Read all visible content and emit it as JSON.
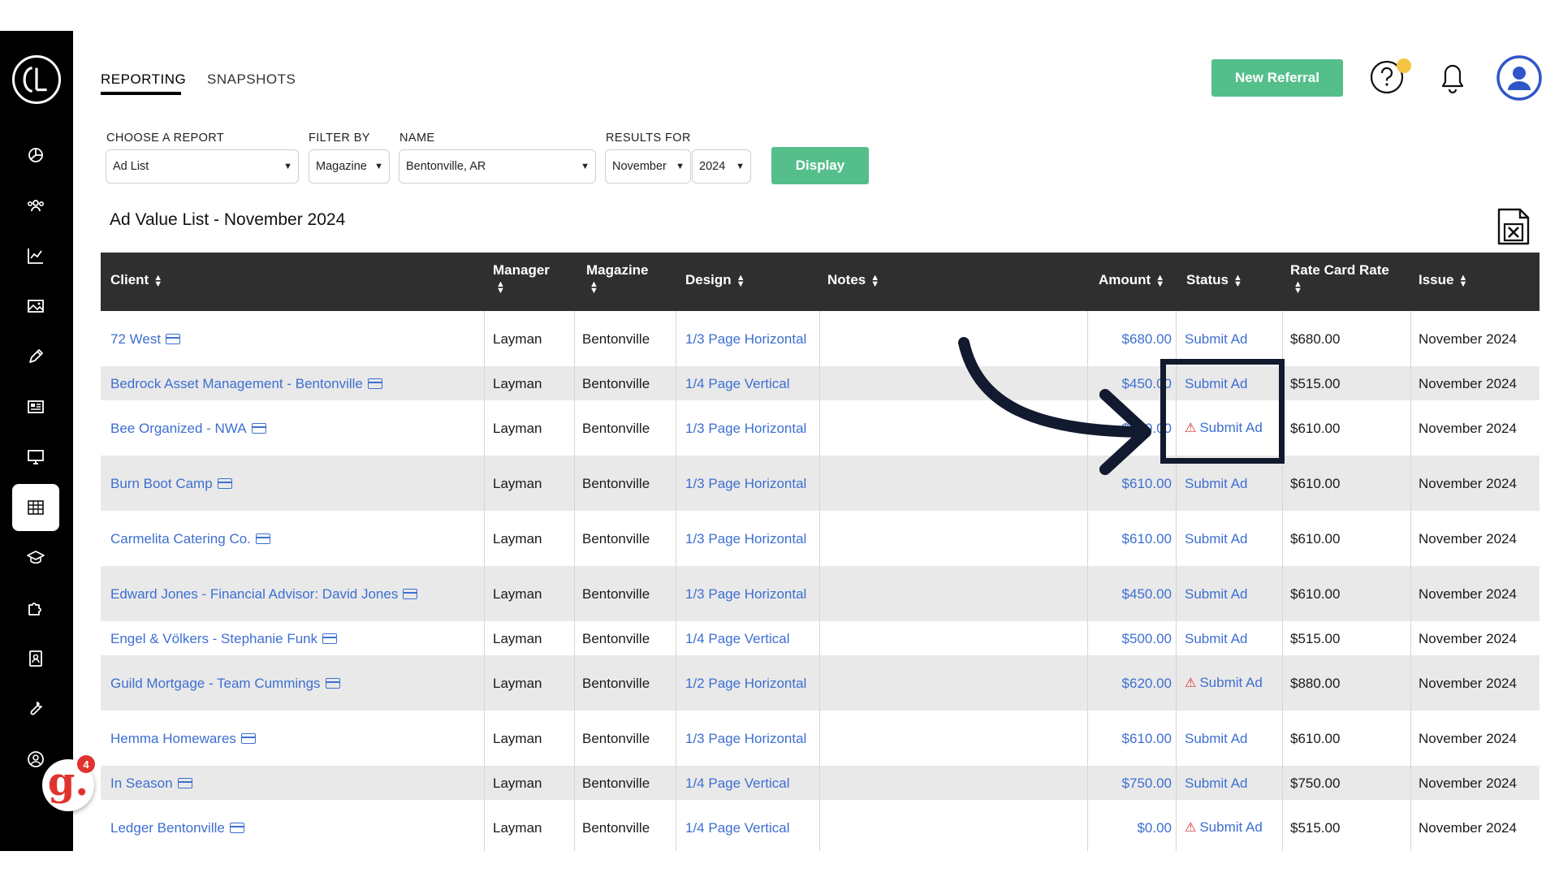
{
  "tabs": [
    {
      "label": "REPORTING",
      "active": true
    },
    {
      "label": "SNAPSHOTS",
      "active": false
    }
  ],
  "header": {
    "new_referral_label": "New Referral",
    "help_icon": "help-circle-icon",
    "bell_icon": "bell-icon",
    "avatar_icon": "user-avatar-icon"
  },
  "sidebar": {
    "logo": "CL",
    "items": [
      {
        "icon": "pie-chart-icon"
      },
      {
        "icon": "users-icon"
      },
      {
        "icon": "line-chart-icon"
      },
      {
        "icon": "image-icon"
      },
      {
        "icon": "pen-icon"
      },
      {
        "icon": "newspaper-icon"
      },
      {
        "icon": "monitor-icon"
      },
      {
        "icon": "table-grid-icon",
        "active": true
      },
      {
        "icon": "graduation-cap-icon"
      },
      {
        "icon": "puzzle-icon"
      },
      {
        "icon": "contact-book-icon"
      },
      {
        "icon": "wrench-icon"
      },
      {
        "icon": "user-circle-icon"
      }
    ]
  },
  "widget": {
    "letter": "g.",
    "count": "4"
  },
  "filters": {
    "report_label": "CHOOSE A REPORT",
    "report_value": "Ad List",
    "filter_label": "FILTER BY",
    "filter_value": "Magazine",
    "name_label": "NAME",
    "name_value": "Bentonville, AR",
    "results_label": "RESULTS FOR",
    "month_value": "November",
    "year_value": "2024",
    "display_label": "Display"
  },
  "page_title": "Ad Value List - November 2024",
  "colors": {
    "accent_green": "#55bf8b",
    "link_blue": "#3d6fd1",
    "header_dark": "#2f2f2f",
    "warning_red": "#d32f2f"
  },
  "table": {
    "headers": {
      "client": "Client",
      "manager": "Manager",
      "magazine": "Magazine",
      "design": "Design",
      "notes": "Notes",
      "amount": "Amount",
      "status": "Status",
      "rate": "Rate Card Rate",
      "issue": "Issue"
    },
    "rows": [
      {
        "client": "72 West",
        "manager": "Layman",
        "magazine": "Bentonville",
        "design": "1/3 Page Horizontal",
        "amount": "$680.00",
        "status": "Submit Ad",
        "warn": false,
        "rate": "$680.00",
        "issue": "November 2024"
      },
      {
        "client": "Bedrock Asset Management - Bentonville",
        "manager": "Layman",
        "magazine": "Bentonville",
        "design": "1/4 Page Vertical",
        "amount": "$450.00",
        "status": "Submit Ad",
        "warn": false,
        "rate": "$515.00",
        "issue": "November 2024"
      },
      {
        "client": "Bee Organized - NWA",
        "manager": "Layman",
        "magazine": "Bentonville",
        "design": "1/3 Page Horizontal",
        "amount": "$610.00",
        "status": "Submit Ad",
        "warn": true,
        "rate": "$610.00",
        "issue": "November 2024"
      },
      {
        "client": "Burn Boot Camp",
        "manager": "Layman",
        "magazine": "Bentonville",
        "design": "1/3 Page Horizontal",
        "amount": "$610.00",
        "status": "Submit Ad",
        "warn": false,
        "rate": "$610.00",
        "issue": "November 2024"
      },
      {
        "client": "Carmelita Catering Co.",
        "manager": "Layman",
        "magazine": "Bentonville",
        "design": "1/3 Page Horizontal",
        "amount": "$610.00",
        "status": "Submit Ad",
        "warn": false,
        "rate": "$610.00",
        "issue": "November 2024"
      },
      {
        "client": "Edward Jones - Financial Advisor: David Jones",
        "manager": "Layman",
        "magazine": "Bentonville",
        "design": "1/3 Page Horizontal",
        "amount": "$450.00",
        "status": "Submit Ad",
        "warn": false,
        "rate": "$610.00",
        "issue": "November 2024"
      },
      {
        "client": "Engel & Völkers - Stephanie Funk",
        "manager": "Layman",
        "magazine": "Bentonville",
        "design": "1/4 Page Vertical",
        "amount": "$500.00",
        "status": "Submit Ad",
        "warn": false,
        "rate": "$515.00",
        "issue": "November 2024"
      },
      {
        "client": "Guild Mortgage - Team Cummings",
        "manager": "Layman",
        "magazine": "Bentonville",
        "design": "1/2 Page Horizontal",
        "amount": "$620.00",
        "status": "Submit Ad",
        "warn": true,
        "rate": "$880.00",
        "issue": "November 2024"
      },
      {
        "client": "Hemma Homewares",
        "manager": "Layman",
        "magazine": "Bentonville",
        "design": "1/3 Page Horizontal",
        "amount": "$610.00",
        "status": "Submit Ad",
        "warn": false,
        "rate": "$610.00",
        "issue": "November 2024"
      },
      {
        "client": "In Season",
        "manager": "Layman",
        "magazine": "Bentonville",
        "design": "1/4 Page Vertical",
        "amount": "$750.00",
        "status": "Submit Ad",
        "warn": false,
        "rate": "$750.00",
        "issue": "November 2024"
      },
      {
        "client": "Ledger Bentonville",
        "manager": "Layman",
        "magazine": "Bentonville",
        "design": "1/4 Page Vertical",
        "amount": "$0.00",
        "status": "Submit Ad",
        "warn": true,
        "rate": "$515.00",
        "issue": "November 2024"
      }
    ]
  }
}
